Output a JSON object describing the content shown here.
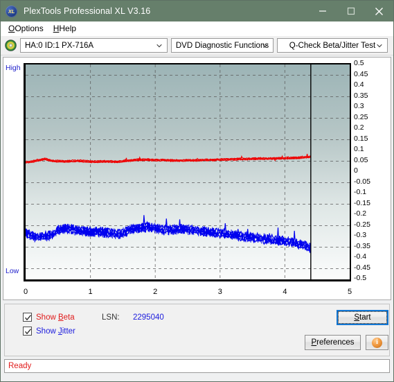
{
  "window": {
    "title": "PlexTools Professional XL V3.16",
    "app_icon": "XL",
    "minimize_icon": "minimize-icon",
    "maximize_icon": "maximize-icon",
    "close_icon": "close-icon"
  },
  "menubar": {
    "items": [
      {
        "label": "Options",
        "mnemonic": "O"
      },
      {
        "label": "Help",
        "mnemonic": "H"
      }
    ]
  },
  "toolbar": {
    "disc_icon": "disc-icon",
    "drive_select": "HA:0 ID:1  PX-716A",
    "function_select": "DVD Diagnostic Functions",
    "test_select": "Q-Check Beta/Jitter Test"
  },
  "chart": {
    "high_label": "High",
    "low_label": "Low"
  },
  "controls": {
    "show_beta_label": "Show Beta",
    "show_beta_mnemonic": "B",
    "show_beta_checked": true,
    "show_jitter_label": "Show Jitter",
    "show_jitter_mnemonic": "J",
    "show_jitter_checked": true,
    "lsn_label": "LSN:",
    "lsn_value": "2295040",
    "start_label": "Start",
    "start_mnemonic": "S",
    "preferences_label": "Preferences",
    "preferences_mnemonic": "P",
    "info_label": "i",
    "info_icon": "info-icon"
  },
  "statusbar": {
    "text": "Ready"
  },
  "colors": {
    "titlebar": "#667f6b",
    "beta_trace": "#ee0000",
    "jitter_trace": "#0000ee",
    "accent_focus": "#1277d4",
    "status_text": "#e01b1b",
    "axis_label_blue": "#2222cc"
  },
  "chart_data": {
    "type": "line",
    "title": "Q-Check Beta/Jitter Test",
    "xlabel": "",
    "ylabel": "",
    "xlim": [
      0,
      5
    ],
    "ylim": [
      -0.5,
      0.5
    ],
    "grid": true,
    "legend": "checkbox-toggles",
    "x_ticks": [
      0,
      1,
      2,
      3,
      4,
      5
    ],
    "x_tick_labels": [
      "0",
      "1",
      "2",
      "3",
      "4",
      "5"
    ],
    "y_ticks": [
      0.5,
      0.45,
      0.4,
      0.35,
      0.3,
      0.25,
      0.2,
      0.15,
      0.1,
      0.05,
      0,
      -0.05,
      -0.1,
      -0.15,
      -0.2,
      -0.25,
      -0.3,
      -0.35,
      -0.4,
      -0.45,
      -0.5
    ],
    "y_tick_labels": [
      "0.5",
      "0.45",
      "0.4",
      "0.35",
      "0.3",
      "0.25",
      "0.2",
      "0.15",
      "0.1",
      "0.05",
      "0",
      "-0.05",
      "-0.1",
      "-0.15",
      "-0.2",
      "-0.25",
      "-0.3",
      "-0.35",
      "-0.4",
      "-0.45",
      "-0.5"
    ],
    "gridline_y_values": [
      0.45,
      0.35,
      0.25,
      0.15,
      0.05,
      -0.05,
      -0.15,
      -0.25,
      -0.35,
      -0.45
    ],
    "gridline_x_values": [
      1,
      2,
      3,
      4
    ],
    "cursor_x": 4.4,
    "data_end_x": 4.4,
    "series": [
      {
        "name": "Beta",
        "color": "#ee0000",
        "x": [
          0.0,
          0.1,
          0.2,
          0.3,
          0.4,
          0.5,
          0.6,
          0.7,
          0.8,
          0.9,
          1.0,
          1.1,
          1.2,
          1.3,
          1.4,
          1.5,
          1.6,
          1.7,
          1.8,
          1.9,
          2.0,
          2.1,
          2.2,
          2.3,
          2.4,
          2.5,
          2.6,
          2.7,
          2.8,
          2.9,
          3.0,
          3.1,
          3.2,
          3.3,
          3.4,
          3.5,
          3.6,
          3.7,
          3.8,
          3.9,
          4.0,
          4.1,
          4.2,
          4.3,
          4.4
        ],
        "values": [
          0.045,
          0.048,
          0.055,
          0.06,
          0.052,
          0.05,
          0.049,
          0.05,
          0.052,
          0.05,
          0.048,
          0.048,
          0.049,
          0.048,
          0.047,
          0.05,
          0.053,
          0.056,
          0.057,
          0.056,
          0.055,
          0.055,
          0.054,
          0.053,
          0.053,
          0.054,
          0.054,
          0.055,
          0.056,
          0.056,
          0.057,
          0.058,
          0.059,
          0.06,
          0.06,
          0.061,
          0.062,
          0.062,
          0.062,
          0.063,
          0.064,
          0.065,
          0.066,
          0.068,
          0.07
        ],
        "noise_amplitude": 0.008
      },
      {
        "name": "Jitter",
        "color": "#0000ee",
        "x": [
          0.0,
          0.1,
          0.2,
          0.3,
          0.4,
          0.5,
          0.6,
          0.7,
          0.8,
          0.9,
          1.0,
          1.1,
          1.2,
          1.3,
          1.4,
          1.5,
          1.6,
          1.7,
          1.8,
          1.9,
          2.0,
          2.1,
          2.2,
          2.3,
          2.4,
          2.5,
          2.6,
          2.7,
          2.8,
          2.9,
          3.0,
          3.1,
          3.2,
          3.3,
          3.4,
          3.5,
          3.6,
          3.7,
          3.8,
          3.9,
          4.0,
          4.1,
          4.2,
          4.3,
          4.4
        ],
        "values": [
          -0.28,
          -0.3,
          -0.305,
          -0.3,
          -0.295,
          -0.27,
          -0.265,
          -0.268,
          -0.272,
          -0.275,
          -0.278,
          -0.28,
          -0.282,
          -0.285,
          -0.288,
          -0.285,
          -0.27,
          -0.262,
          -0.258,
          -0.255,
          -0.262,
          -0.268,
          -0.27,
          -0.268,
          -0.265,
          -0.268,
          -0.272,
          -0.275,
          -0.278,
          -0.282,
          -0.285,
          -0.29,
          -0.295,
          -0.3,
          -0.302,
          -0.305,
          -0.308,
          -0.312,
          -0.315,
          -0.318,
          -0.322,
          -0.328,
          -0.335,
          -0.342,
          -0.355
        ],
        "noise_amplitude": 0.03
      }
    ]
  }
}
